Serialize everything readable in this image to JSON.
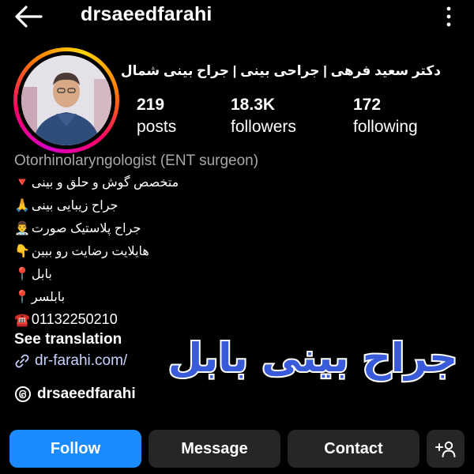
{
  "header": {
    "username": "drsaeedfarahi",
    "back_icon": "arrow-left-icon",
    "more_icon": "vertical-ellipsis-icon"
  },
  "profile": {
    "display_name": "دکتر سعید فرهی | جراحی بینی | جراح بینی شمال",
    "stats": {
      "posts_count": "219",
      "posts_label": "posts",
      "followers_count": "18.3K",
      "followers_label": "followers",
      "following_count": "172",
      "following_label": "following"
    },
    "category": "Otorhinolaryngologist (ENT surgeon)",
    "bio": [
      {
        "text": "متخصص گوش و حلق و بینی",
        "emoji": "🔻"
      },
      {
        "text": "جراح زیبایی بینی",
        "emoji": "🙏"
      },
      {
        "text": "جراح پلاستیک صورت",
        "emoji": "👨‍⚕️"
      },
      {
        "text": "هایلایت رضایت رو ببین",
        "emoji": "👇"
      },
      {
        "text": "بابل",
        "emoji": "📍"
      },
      {
        "text": "بابلسر",
        "emoji": "📍"
      },
      {
        "text": "01132250210",
        "emoji": "☎️"
      }
    ],
    "see_translation": "See translation",
    "link": "dr-farahi.com/",
    "threads_handle": "drsaeedfarahi"
  },
  "overlay": {
    "text": "جراح بینی بابل"
  },
  "actions": {
    "follow": "Follow",
    "message": "Message",
    "contact": "Contact",
    "add_user_icon": "add-person-icon"
  },
  "colors": {
    "background": "#000000",
    "follow_button": "#1a8cff",
    "secondary_button": "#262626",
    "link": "#c7d3ff",
    "muted_text": "#a8a8a8",
    "overlay_text": "#3a5bd9"
  }
}
